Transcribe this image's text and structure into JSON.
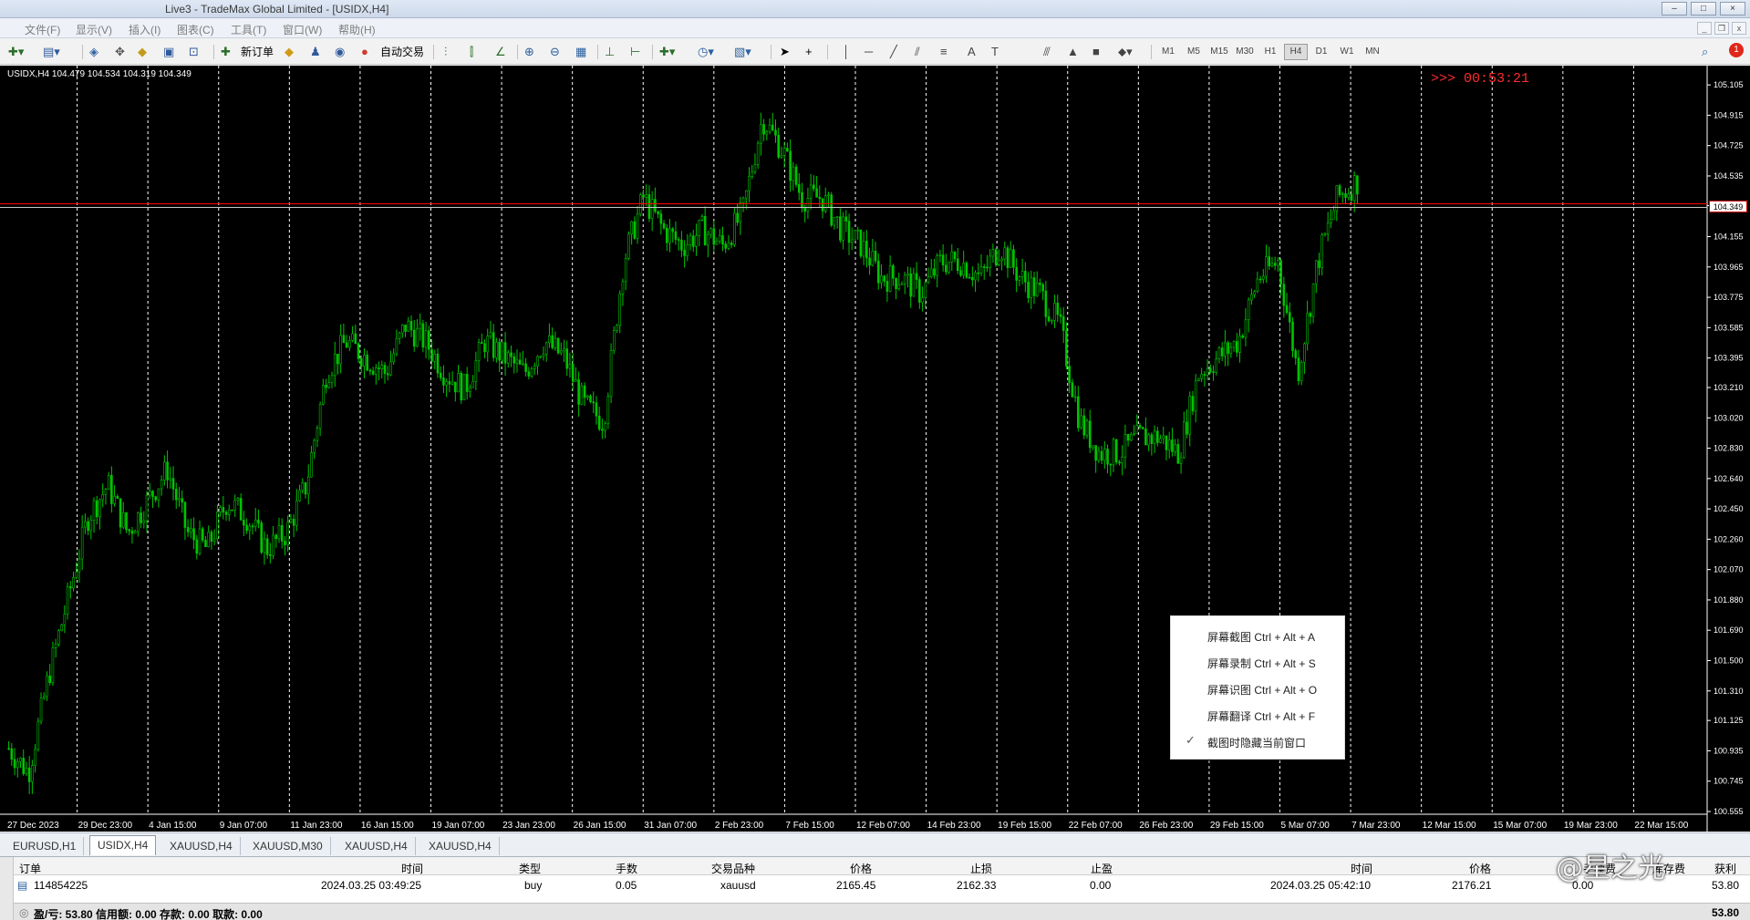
{
  "window": {
    "title": "Live3 - TradeMax Global Limited - [USIDX,H4]",
    "min_label": "–",
    "max_label": "□",
    "close_label": "×"
  },
  "menu": {
    "items": [
      "文件(F)",
      "显示(V)",
      "插入(I)",
      "图表(C)",
      "工具(T)",
      "窗口(W)",
      "帮助(H)"
    ]
  },
  "toolbar": {
    "new_order": "新订单",
    "auto_trading": "自动交易",
    "timeframes": [
      "M1",
      "M5",
      "M15",
      "M30",
      "H1",
      "H4",
      "D1",
      "W1",
      "MN"
    ],
    "active_timeframe": "H4",
    "notification_count": "1"
  },
  "chart": {
    "symbol_info": "USIDX,H4  104.479 104.534 104.319 104.349",
    "countdown": ">>> 00:53:21",
    "current_price": "104.349",
    "colors": {
      "background": "#000000",
      "candles": "#00c400",
      "grid": "#ffffff",
      "price_line": "#ff0000"
    }
  },
  "chart_data": {
    "type": "candlestick",
    "title": "USIDX,H4",
    "xlabel": "",
    "ylabel": "",
    "ylim": [
      100.555,
      105.18
    ],
    "price_ticks": [
      "105.105",
      "104.915",
      "104.725",
      "104.535",
      "104.349",
      "104.155",
      "103.965",
      "103.775",
      "103.585",
      "103.395",
      "103.210",
      "103.020",
      "102.830",
      "102.640",
      "102.450",
      "102.260",
      "102.070",
      "101.880",
      "101.690",
      "101.500",
      "101.310",
      "101.125",
      "100.935",
      "100.745",
      "100.555"
    ],
    "time_ticks": [
      "27 Dec 2023",
      "29 Dec 23:00",
      "4 Jan 15:00",
      "9 Jan 07:00",
      "11 Jan 23:00",
      "16 Jan 15:00",
      "19 Jan 07:00",
      "23 Jan 23:00",
      "26 Jan 15:00",
      "31 Jan 07:00",
      "2 Feb 23:00",
      "7 Feb 15:00",
      "12 Feb 07:00",
      "14 Feb 23:00",
      "19 Feb 15:00",
      "22 Feb 07:00",
      "26 Feb 23:00",
      "29 Feb 15:00",
      "5 Mar 07:00",
      "7 Mar 23:00",
      "12 Mar 15:00",
      "15 Mar 07:00",
      "19 Mar 23:00",
      "22 Mar 15:00"
    ],
    "close_path": [
      100.95,
      100.8,
      101.4,
      101.9,
      102.4,
      102.6,
      102.3,
      102.5,
      102.7,
      102.3,
      102.2,
      102.5,
      102.4,
      102.2,
      102.3,
      102.6,
      103.3,
      103.5,
      103.4,
      103.3,
      103.6,
      103.5,
      103.3,
      103.2,
      103.5,
      103.4,
      103.3,
      103.5,
      103.4,
      103.1,
      103.0,
      104.0,
      104.4,
      104.2,
      104.1,
      104.2,
      104.1,
      104.3,
      104.9,
      104.7,
      104.4,
      104.4,
      104.2,
      104.1,
      103.9,
      103.9,
      103.8,
      104.0,
      104.0,
      103.9,
      104.1,
      103.9,
      103.8,
      103.6,
      103.0,
      102.8,
      102.8,
      102.9,
      102.9,
      102.8,
      103.3,
      103.4,
      103.5,
      103.9,
      104.0,
      103.3,
      104.0,
      104.4,
      104.5
    ],
    "current_price": 104.349
  },
  "context_menu": {
    "items": [
      "屏幕截图 Ctrl + Alt + A",
      "屏幕录制 Ctrl + Alt + S",
      "屏幕识图 Ctrl + Alt + O",
      "屏幕翻译 Ctrl + Alt + F",
      "截图时隐藏当前窗口"
    ],
    "check": "✓"
  },
  "tabs": {
    "items": [
      "EURUSD,H1",
      "USIDX,H4",
      "XAUUSD,H4",
      "XAUUSD,M30",
      "XAUUSD,H4",
      "XAUUSD,H4"
    ],
    "active_index": 1
  },
  "terminal": {
    "headers": [
      "订单",
      "时间",
      "类型",
      "手数",
      "交易品种",
      "价格",
      "止损",
      "止盈",
      "时间",
      "价格",
      "手续费",
      "库存费",
      "获利"
    ],
    "row": {
      "order": "114854225",
      "open_time": "2024.03.25 03:49:25",
      "type": "buy",
      "lots": "0.05",
      "symbol": "xauusd",
      "open_price": "2165.45",
      "sl": "2162.33",
      "tp": "0.00",
      "close_time": "2024.03.25 05:42:10",
      "close_price": "2176.21",
      "swap": "0.00",
      "profit": "53.80"
    },
    "footer": "盈/亏: 53.80  信用额: 0.00  存款: 0.00  取款: 0.00",
    "footer_total": "53.80"
  },
  "watermark": "@星之光"
}
